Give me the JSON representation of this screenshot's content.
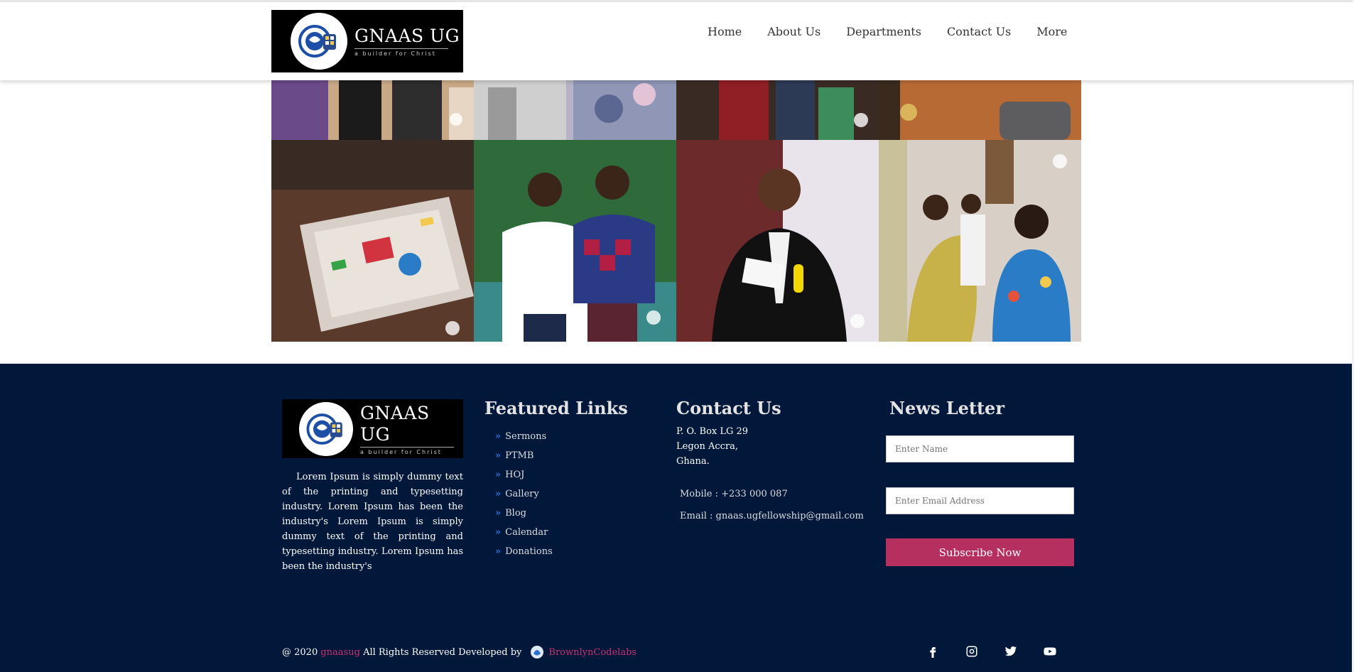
{
  "header": {
    "logo": {
      "title": "GNAAS UG",
      "tagline": "a builder for Christ"
    },
    "nav": [
      "Home",
      "About Us",
      "Departments",
      "Contact Us",
      "More"
    ]
  },
  "gallery": {
    "tiles": [
      {
        "name": "photo-youth-top-1",
        "colors": [
          "#6b4a8a",
          "#1b1b1b",
          "#c9a886"
        ]
      },
      {
        "name": "photo-youth-top-2",
        "colors": [
          "#cfcfcf",
          "#2f3a4a",
          "#b7b3c7"
        ]
      },
      {
        "name": "photo-congregation-top",
        "colors": [
          "#3a2a24",
          "#8f1f24",
          "#2c3a56"
        ]
      },
      {
        "name": "photo-congregation-top-4",
        "colors": [
          "#b86a34",
          "#3a2a1e",
          "#5d5d60"
        ]
      },
      {
        "name": "photo-board-game",
        "colors": [
          "#5a3b2b",
          "#d8d0c8",
          "#d2343f"
        ]
      },
      {
        "name": "photo-two-friends",
        "colors": [
          "#2e6a3a",
          "#ffffff",
          "#2a3a85"
        ]
      },
      {
        "name": "photo-speaker",
        "colors": [
          "#6d2a2a",
          "#f2f2f2",
          "#111111"
        ]
      },
      {
        "name": "photo-congregation-singing",
        "colors": [
          "#d8cfc6",
          "#c7b24a",
          "#2a7cc7"
        ]
      }
    ]
  },
  "footer": {
    "logo": {
      "title": "GNAAS UG",
      "tagline": "a builder for Christ"
    },
    "about": "Lorem Ipsum is simply dummy text of the printing and typesetting industry. Lorem Ipsum has been the industry's Lorem Ipsum is simply dummy text of the printing and typesetting industry. Lorem Ipsum has been the industry's",
    "featured": {
      "heading": "Featured Links",
      "links": [
        "Sermons",
        "PTMB",
        "HOJ",
        "Gallery",
        "Blog",
        "Calendar",
        "Donations"
      ]
    },
    "contact": {
      "heading": "Contact Us",
      "address": [
        "P. O. Box LG 29",
        "Legon Accra,",
        "Ghana."
      ],
      "mobile": "Mobile : +233 000 087",
      "email": "Email : gnaas.ugfellowship@gmail.com"
    },
    "newsletter": {
      "heading": "News Letter",
      "name_placeholder": "Enter Name",
      "email_placeholder": "Enter Email Address",
      "button": "Subscribe Now"
    },
    "copyright": {
      "prefix": "@ 2020",
      "site": "gnaasug",
      "middle": "All Rights Reserved Developed by",
      "developer": "BrownlynCodelabs"
    },
    "socials": [
      "facebook-icon",
      "instagram-icon",
      "twitter-icon",
      "youtube-icon"
    ]
  },
  "colors": {
    "footer_bg": "#02183b",
    "accent": "#b5305f",
    "link_chevron": "#2a6fd6"
  }
}
